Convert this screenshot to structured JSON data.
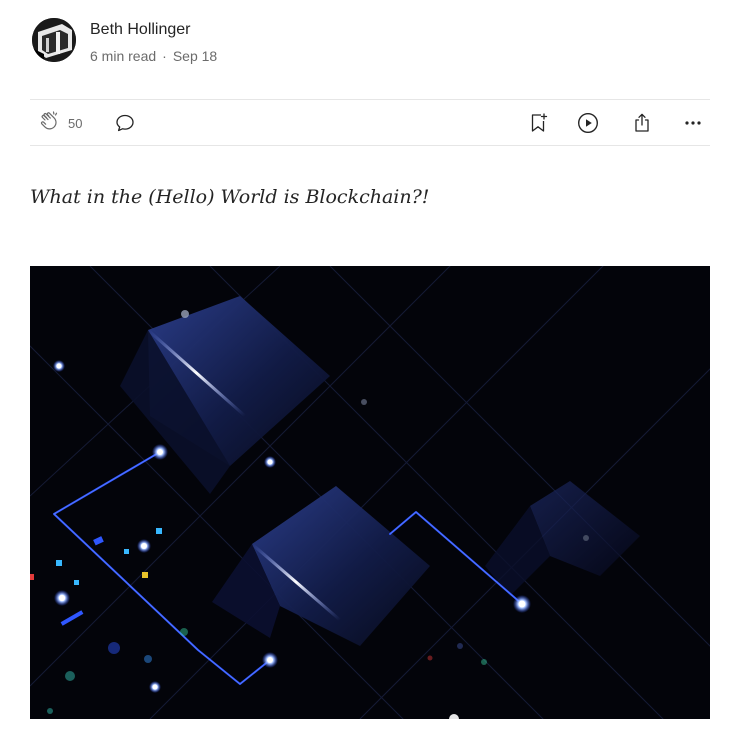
{
  "author": {
    "name": "Beth Hollinger",
    "read_time": "6 min read",
    "separator": "·",
    "date": "Sep 18"
  },
  "actions": {
    "clap_count": "50",
    "icons": [
      "clap-icon",
      "comment-icon",
      "bookmark-add-icon",
      "play-icon",
      "share-icon",
      "more-icon"
    ]
  },
  "article": {
    "subtitle": "What in the (Hello) World is Blockchain?!",
    "hero_alt": "blockchain abstract image"
  },
  "colors": {
    "text": "#242424",
    "muted": "#6b6b6b",
    "divider": "#e6e6e6",
    "hero_background": "#03040a",
    "hero_accent": "#2f57ff"
  }
}
